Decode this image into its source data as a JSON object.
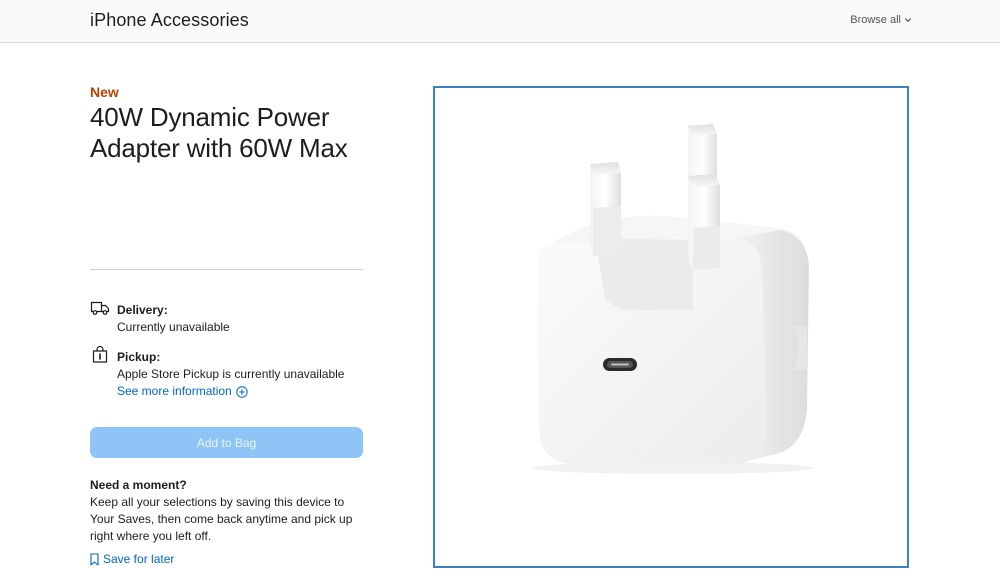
{
  "header": {
    "brand": "iPhone Accessories",
    "browse_label": "Browse all",
    "browse_icon": "chevron-down-icon"
  },
  "product": {
    "badge": "New",
    "title": "40W Dynamic Power Adapter with 60W Max"
  },
  "availability": {
    "delivery": {
      "icon": "truck-icon",
      "label": "Delivery:",
      "value": "Currently unavailable"
    },
    "pickup": {
      "icon": "bag-icon",
      "label": "Pickup:",
      "value": "Apple Store Pickup is currently unavailable",
      "link": "See more information",
      "link_icon": "plus-circle-icon"
    }
  },
  "actions": {
    "add_to_bag": "Add to Bag",
    "add_to_bag_color": "#8ec5f6"
  },
  "save": {
    "title": "Need a moment?",
    "body": "Keep all your selections by saving this device to Your Saves, then come back anytime and pick up right where you left off.",
    "link": "Save for later",
    "link_icon": "bookmark-icon"
  },
  "colors": {
    "link": "#0066cc",
    "new_badge": "#b64400",
    "gallery_border": "#3b82c4"
  }
}
